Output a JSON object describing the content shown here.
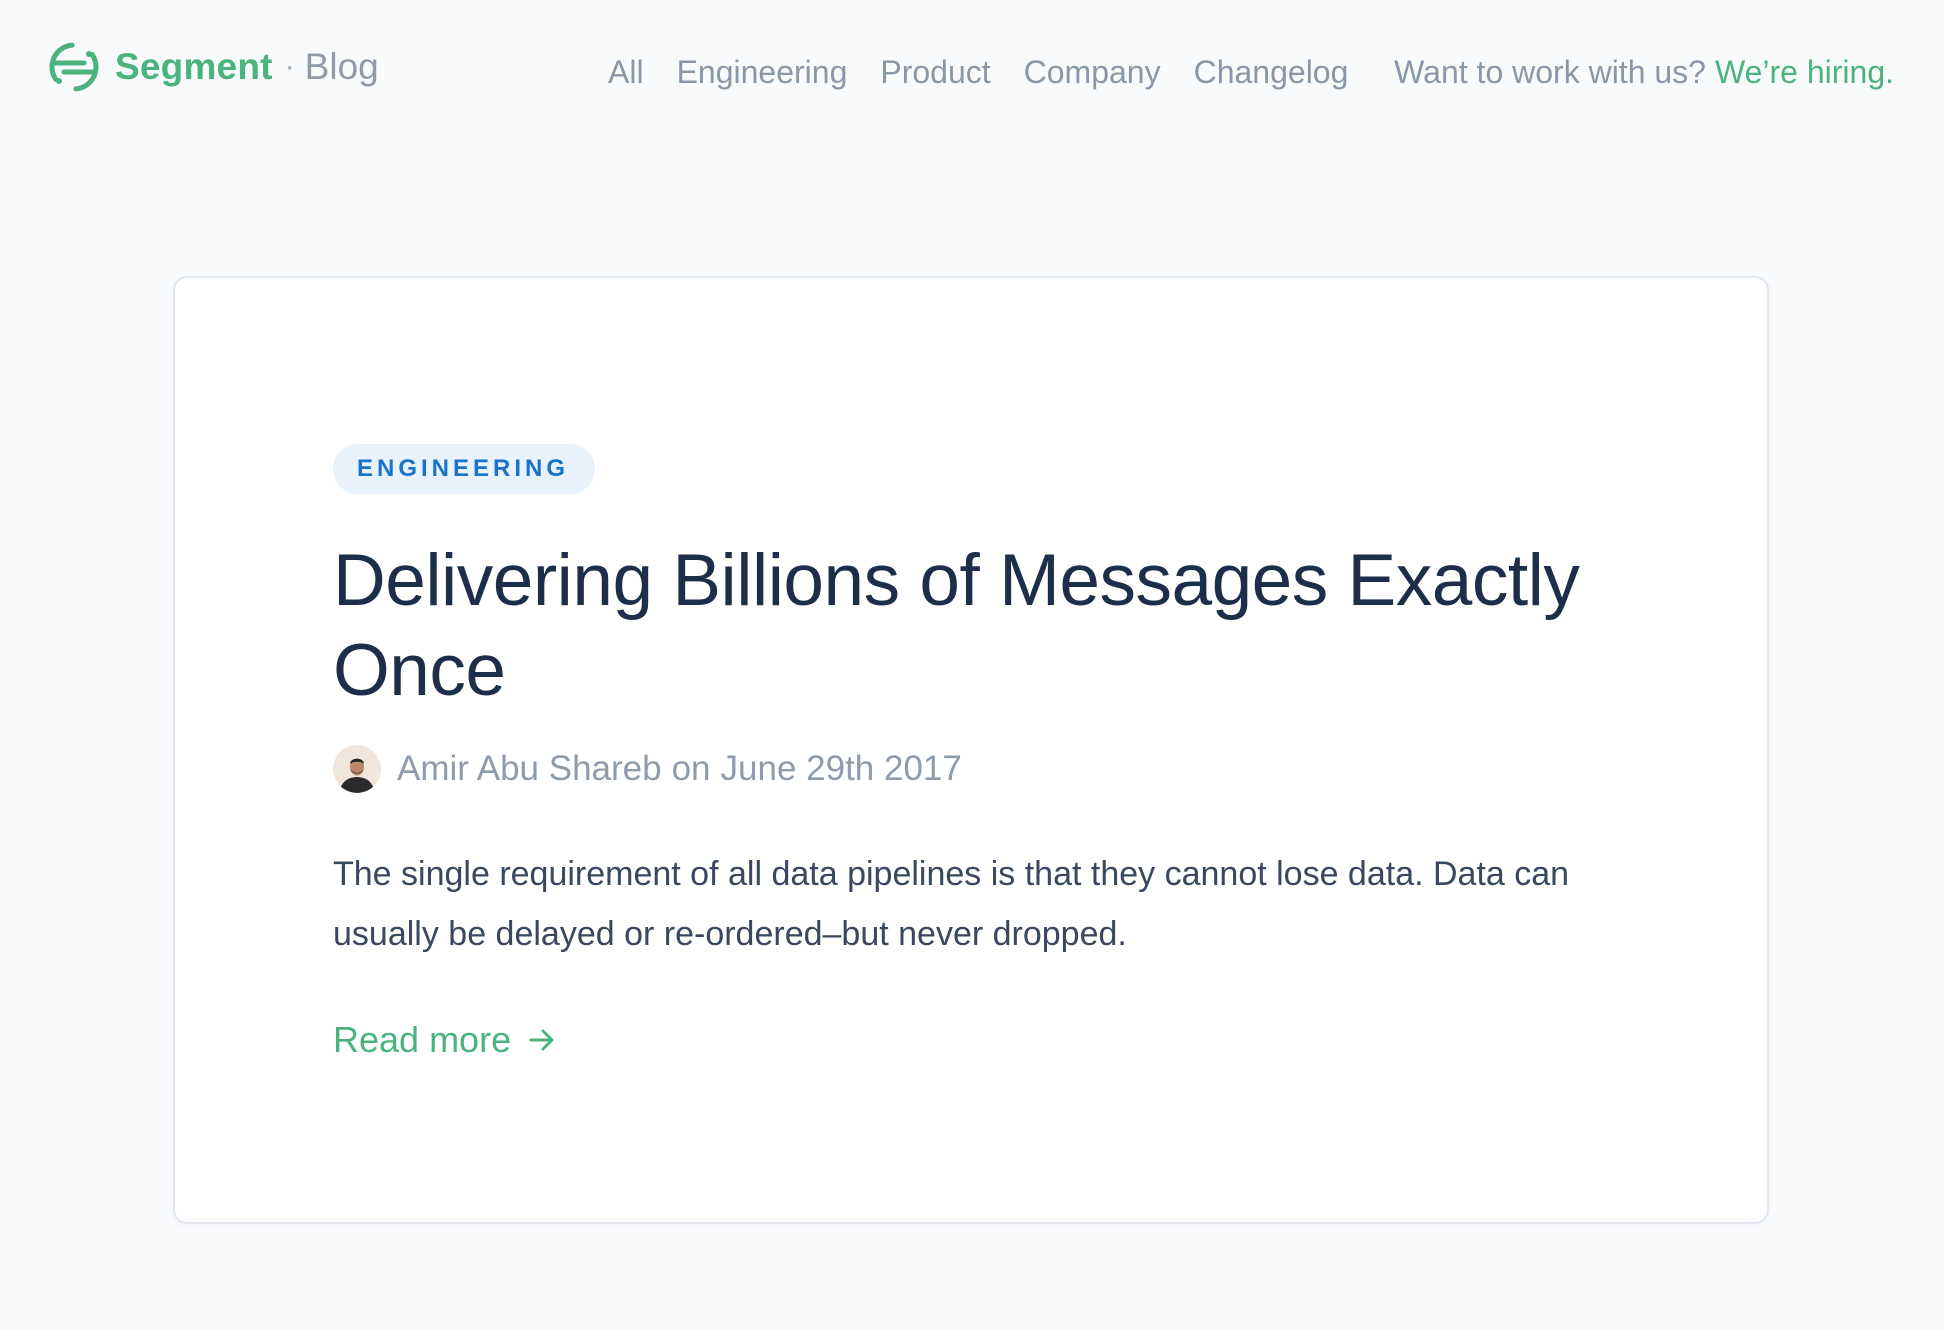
{
  "header": {
    "brand": {
      "logo_icon": "segment-logo-icon",
      "name": "Segment",
      "separator": "·",
      "section": "Blog"
    },
    "nav": [
      {
        "label": "All"
      },
      {
        "label": "Engineering"
      },
      {
        "label": "Product"
      },
      {
        "label": "Company"
      },
      {
        "label": "Changelog"
      }
    ],
    "hiring": {
      "prompt": "Want to work with us?",
      "link": "We’re hiring."
    }
  },
  "post": {
    "category": "ENGINEERING",
    "title": "Delivering Billions of Messages Exactly Once",
    "author": "Amir Abu Shareb",
    "date_prefix": "on",
    "date": "June 29th 2017",
    "excerpt": "The single requirement of all data pipelines is that they cannot lose data. Data can usually be delayed or re-ordered–but never dropped.",
    "read_more": "Read more",
    "read_more_icon": "arrow-right-icon"
  },
  "colors": {
    "background": "#f9fafc",
    "brand_green": "#4bb37d",
    "nav_gray": "#8a97a8",
    "title_navy": "#1c2e4a",
    "tag_blue": "#1a73c8",
    "tag_bg": "#e8f2fc",
    "card_border": "#e2e7ee"
  }
}
